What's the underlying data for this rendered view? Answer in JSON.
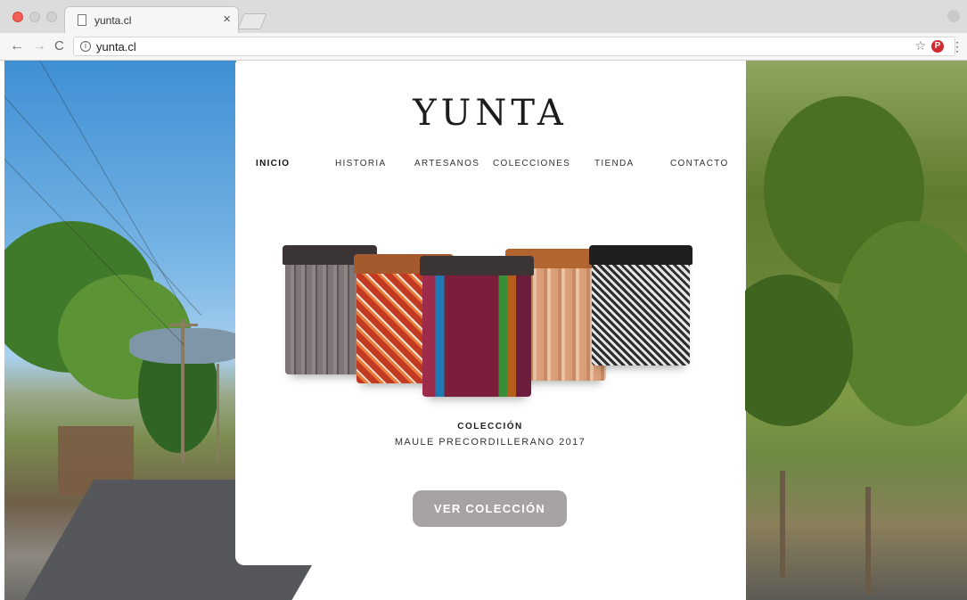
{
  "browser": {
    "tab_title": "yunta.cl",
    "tab_close": "×",
    "url": "yunta.cl",
    "info_glyph": "i",
    "back_glyph": "←",
    "forward_glyph": "→",
    "reload_glyph": "C",
    "star_glyph": "☆",
    "pinterest_glyph": "P",
    "menu_glyph": "⋮"
  },
  "site": {
    "logo": "YUNTA",
    "nav": [
      "INICIO",
      "HISTORIA",
      "ARTESANOS",
      "COLECCIONES",
      "TIENDA",
      "CONTACTO"
    ],
    "active_nav": "INICIO",
    "collection_label": "COLECCIÓN",
    "collection_name": "MAULE PRECORDILLERANO 2017",
    "cta_label": "VER COLECCIÓN"
  },
  "colors": {
    "cta_background": "#a7a3a2",
    "close_button": "#f25f58",
    "pinterest": "#d22a2f"
  },
  "icons": [
    "page-icon",
    "info-icon",
    "star-icon",
    "pinterest-icon",
    "menu-icon",
    "profile-icon"
  ]
}
